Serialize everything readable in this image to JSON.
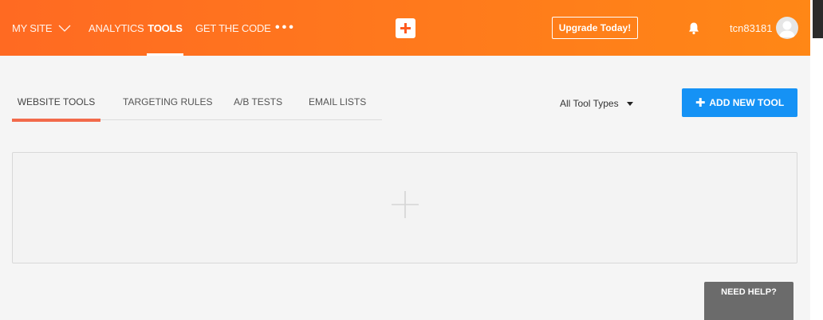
{
  "topbar": {
    "my_site": "MY SITE",
    "analytics": "ANALYTICS",
    "tools": "TOOLS",
    "get_code": "GET THE CODE",
    "more": "•••",
    "upgrade": "Upgrade Today!",
    "username": "tcn83181",
    "icons": [
      "chevron-down-icon",
      "plus-icon",
      "bell-icon",
      "avatar"
    ],
    "colors": {
      "gradient_start": "#ff6a22",
      "gradient_end": "#ff8716",
      "plus_accent": "#ff5a1f"
    }
  },
  "tabs": {
    "website_tools": "WEBSITE TOOLS",
    "targeting_rules": "TARGETING RULES",
    "ab_tests": "A/B TESTS",
    "email_lists": "EMAIL LISTS",
    "active_color": "#f26a4b"
  },
  "filter": {
    "tool_types": "All Tool Types"
  },
  "actions": {
    "add_new_tool": "ADD NEW TOOL",
    "add_color": "#1592f5"
  },
  "help": {
    "label": "NEED HELP?"
  }
}
